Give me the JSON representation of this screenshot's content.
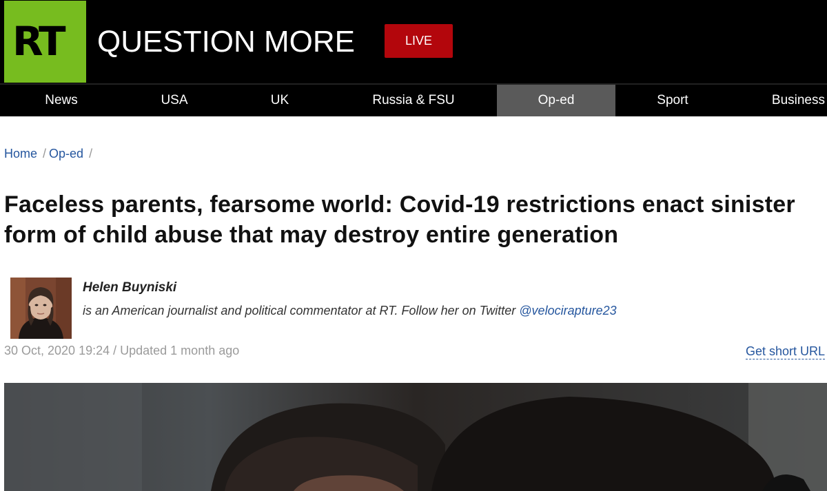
{
  "header": {
    "logo_text": "RT",
    "tagline": "QUESTION MORE",
    "live_label": "LIVE"
  },
  "nav": {
    "items": [
      {
        "label": "News"
      },
      {
        "label": "USA"
      },
      {
        "label": "UK"
      },
      {
        "label": "Russia & FSU"
      },
      {
        "label": "Op-ed",
        "active": true
      },
      {
        "label": "Sport"
      },
      {
        "label": "Business"
      }
    ]
  },
  "breadcrumb": {
    "home": "Home",
    "section": "Op-ed",
    "separator": "/"
  },
  "article": {
    "headline": "Faceless parents, fearsome world: Covid-19 restrictions enact sinister form of child abuse that may destroy entire generation",
    "author_name": "Helen Buyniski",
    "author_bio": "is an American journalist and political commentator at RT. Follow her on Twitter ",
    "author_twitter": "@velocirapture23",
    "date": "30 Oct, 2020 19:24 / Updated 1 month ago",
    "short_url_label": "Get short URL"
  },
  "colors": {
    "brand_green": "#77bc1f",
    "live_red": "#b3060c",
    "link_blue": "#25569e",
    "nav_active": "#5a5a5a"
  }
}
